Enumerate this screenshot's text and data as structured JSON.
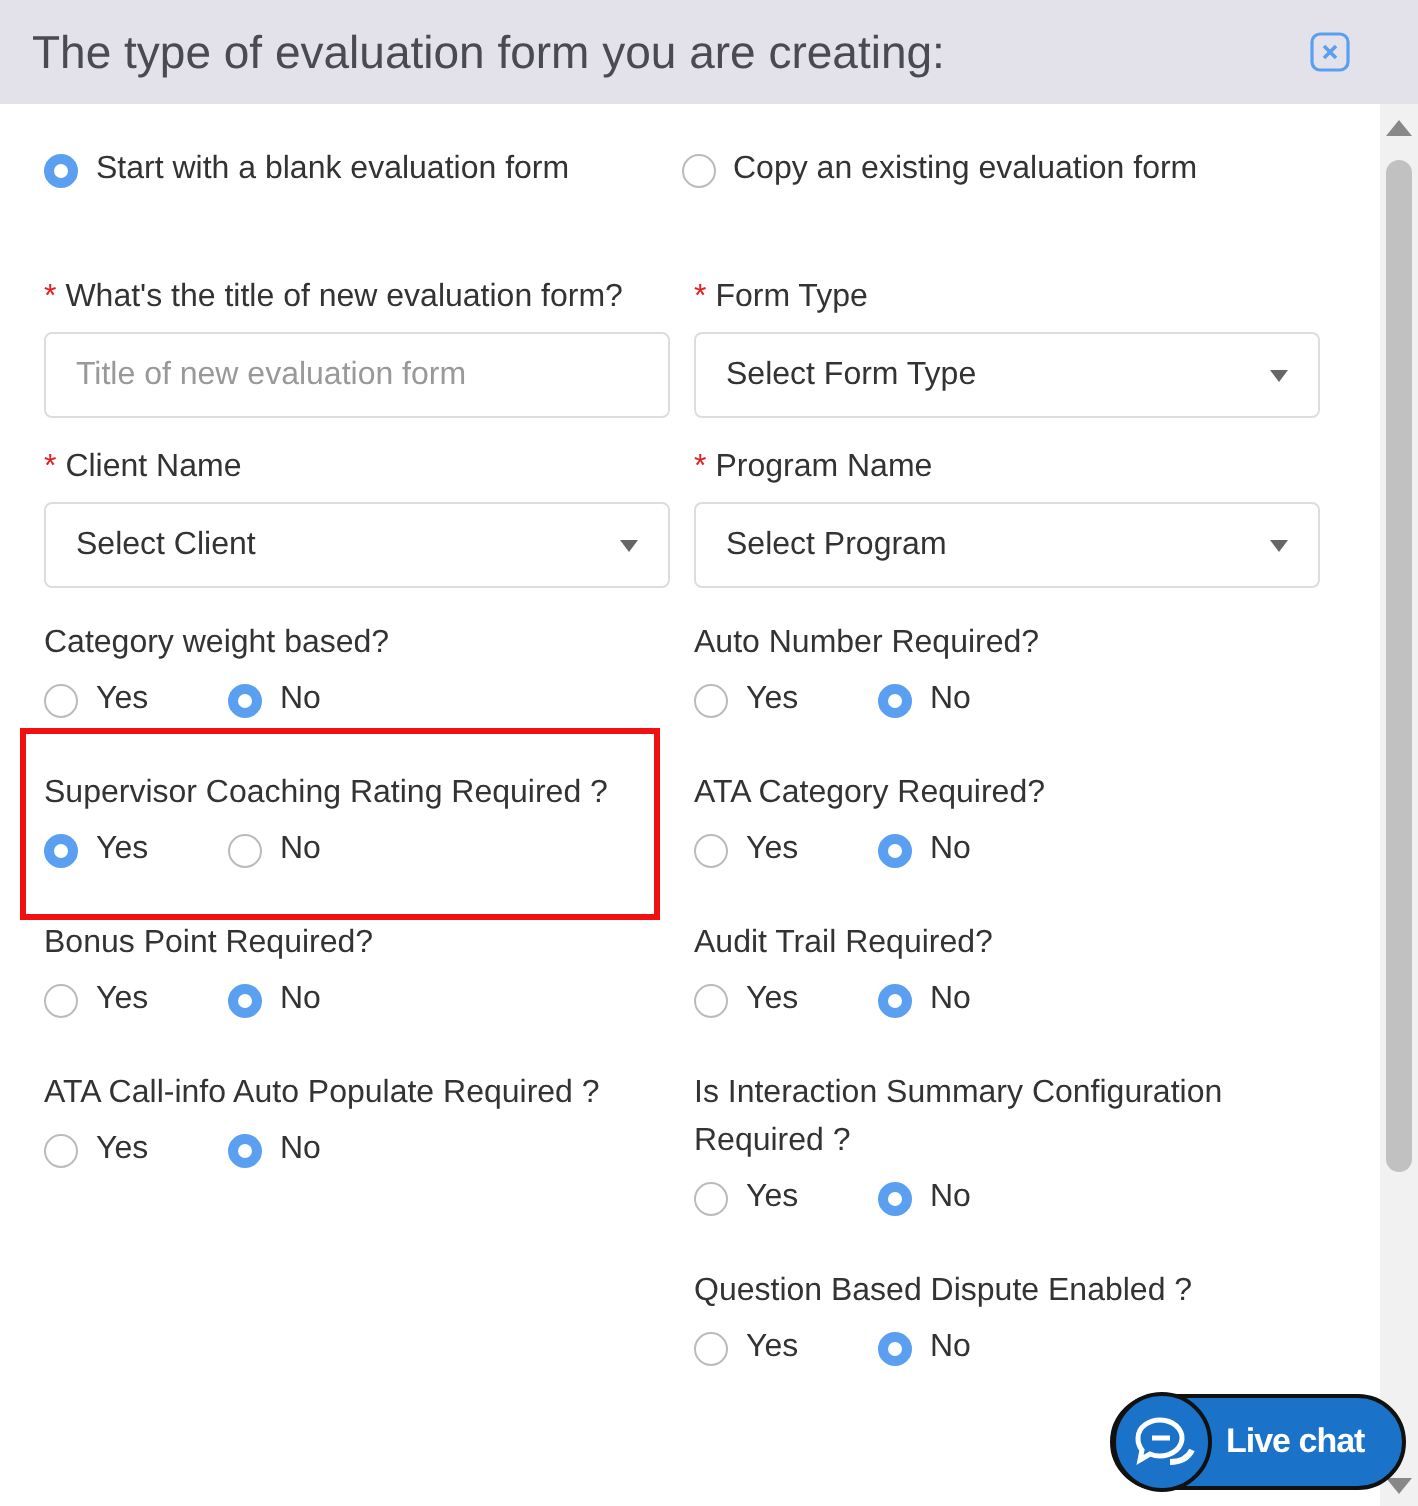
{
  "dialog": {
    "title": "The type of evaluation form you are creating:"
  },
  "start_options": [
    {
      "label": "Start with a blank evaluation form",
      "selected": true
    },
    {
      "label": "Copy an existing evaluation form",
      "selected": false
    }
  ],
  "fields": [
    {
      "kind": "input",
      "label": "What's the title of new evaluation form?",
      "required_mark": "*",
      "placeholder": "Title of new evaluation form"
    },
    {
      "kind": "select",
      "label": "Form Type",
      "required_mark": "*",
      "value": "Select Form Type"
    },
    {
      "kind": "select",
      "label": "Client Name",
      "required_mark": "*",
      "value": "Select Client"
    },
    {
      "kind": "select",
      "label": "Program Name",
      "required_mark": "*",
      "value": "Select Program"
    }
  ],
  "columns": [
    {
      "questions": [
        {
          "label": "Category weight based?",
          "highlighted": false,
          "options": [
            {
              "label": "Yes",
              "selected": false
            },
            {
              "label": "No",
              "selected": true
            }
          ]
        },
        {
          "label": "Supervisor Coaching Rating Required ?",
          "highlighted": true,
          "options": [
            {
              "label": "Yes",
              "selected": true
            },
            {
              "label": "No",
              "selected": false
            }
          ]
        },
        {
          "label": "Bonus Point Required?",
          "highlighted": false,
          "options": [
            {
              "label": "Yes",
              "selected": false
            },
            {
              "label": "No",
              "selected": true
            }
          ]
        },
        {
          "label": "ATA Call-info Auto Populate Required ?",
          "highlighted": false,
          "options": [
            {
              "label": "Yes",
              "selected": false
            },
            {
              "label": "No",
              "selected": true
            }
          ]
        }
      ]
    },
    {
      "questions": [
        {
          "label": "Auto Number Required?",
          "highlighted": false,
          "options": [
            {
              "label": "Yes",
              "selected": false
            },
            {
              "label": "No",
              "selected": true
            }
          ]
        },
        {
          "label": "ATA Category Required?",
          "highlighted": false,
          "options": [
            {
              "label": "Yes",
              "selected": false
            },
            {
              "label": "No",
              "selected": true
            }
          ]
        },
        {
          "label": "Audit Trail Required?",
          "highlighted": false,
          "options": [
            {
              "label": "Yes",
              "selected": false
            },
            {
              "label": "No",
              "selected": true
            }
          ]
        },
        {
          "label": "Is Interaction Summary Configuration Required ?",
          "highlighted": false,
          "options": [
            {
              "label": "Yes",
              "selected": false
            },
            {
              "label": "No",
              "selected": true
            }
          ]
        },
        {
          "label": "Question Based Dispute Enabled ?",
          "highlighted": false,
          "options": [
            {
              "label": "Yes",
              "selected": false
            },
            {
              "label": "No",
              "selected": true
            }
          ]
        }
      ]
    }
  ],
  "live_chat": {
    "label": "Live chat"
  }
}
